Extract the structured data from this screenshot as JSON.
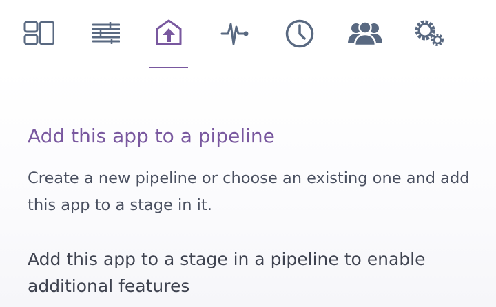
{
  "nav": {
    "tabs": [
      {
        "name": "overview",
        "icon": "layout-icon",
        "active": false
      },
      {
        "name": "resources",
        "icon": "sliders-icon",
        "active": false
      },
      {
        "name": "deploy",
        "icon": "upload-icon",
        "active": true
      },
      {
        "name": "metrics",
        "icon": "pulse-icon",
        "active": false
      },
      {
        "name": "activity",
        "icon": "clock-icon",
        "active": false
      },
      {
        "name": "access",
        "icon": "users-icon",
        "active": false
      },
      {
        "name": "settings",
        "icon": "gears-icon",
        "active": false
      }
    ],
    "icon_color": "#596981",
    "active_color": "#79589f"
  },
  "pipeline": {
    "title": "Add this app to a pipeline",
    "description": "Create a new pipeline or choose an existing one and add this app to a stage in it.",
    "notice": "Add this app to a stage in a pipeline to enable additional features"
  }
}
